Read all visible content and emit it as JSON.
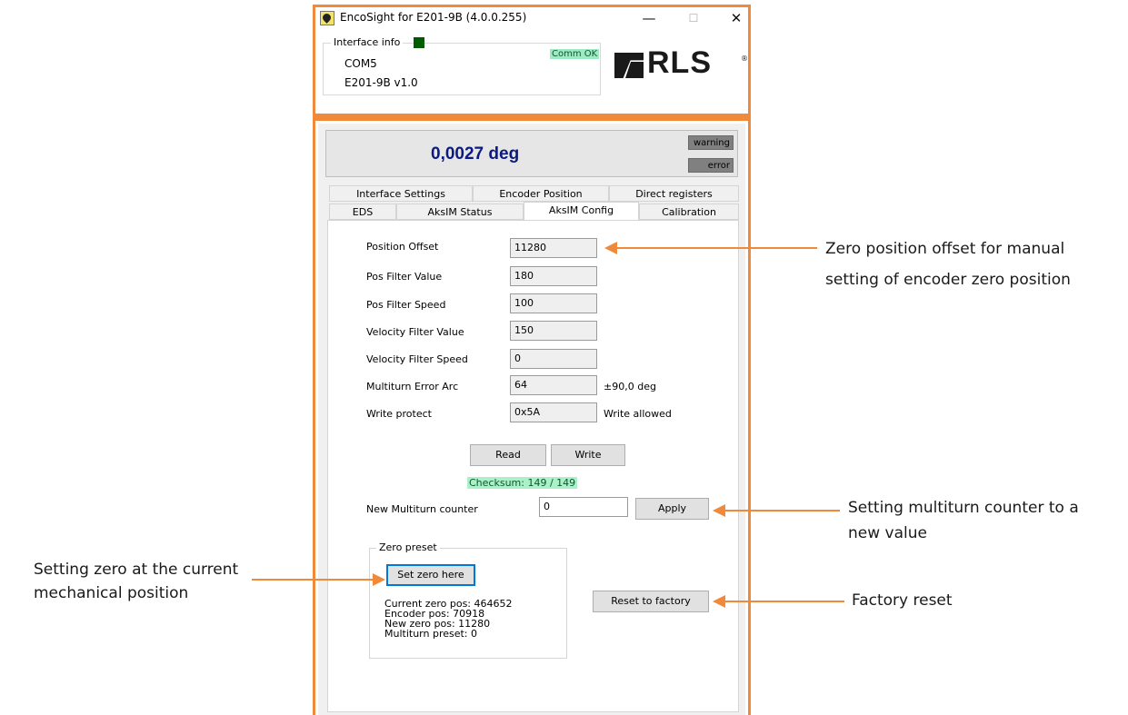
{
  "window": {
    "title": "EncoSight for E201-9B (4.0.0.255)",
    "controls": {
      "minimize": "—",
      "maximize": "☐",
      "close": "✕"
    }
  },
  "interface_info": {
    "legend": "Interface info",
    "status": "Comm OK",
    "port": "COM5",
    "device": "E201-9B v1.0",
    "led_color": "#005a00"
  },
  "logo": {
    "text": "RLS",
    "registered": "®"
  },
  "readout": {
    "value": "0,0027 deg",
    "warning": "warning",
    "error": "error"
  },
  "tabs": {
    "row1": [
      "Interface Settings",
      "Encoder Position",
      "Direct registers"
    ],
    "row2": [
      "EDS",
      "AksIM Status",
      "AksIM Config",
      "Calibration"
    ],
    "active": "AksIM Config"
  },
  "config": {
    "fields": [
      {
        "label": "Position Offset",
        "value": "11280",
        "unit": ""
      },
      {
        "label": "Pos Filter Value",
        "value": "180",
        "unit": ""
      },
      {
        "label": "Pos Filter Speed",
        "value": "100",
        "unit": ""
      },
      {
        "label": "Velocity Filter Value",
        "value": "150",
        "unit": ""
      },
      {
        "label": "Velocity Filter Speed",
        "value": "0",
        "unit": ""
      },
      {
        "label": "Multiturn Error Arc",
        "value": "64",
        "unit": "±90,0 deg"
      },
      {
        "label": "Write protect",
        "value": "0x5A",
        "unit": "Write allowed"
      }
    ],
    "read_label": "Read",
    "write_label": "Write",
    "checksum": "Checksum: 149 / 149",
    "multiturn_label": "New Multiturn counter",
    "multiturn_value": "0",
    "apply_label": "Apply"
  },
  "zero_preset": {
    "legend": "Zero preset",
    "set_zero_label": "Set zero here",
    "current_zero": "Current zero pos: 464652",
    "encoder_pos": "Encoder pos: 70918",
    "new_zero": "New zero pos: 11280",
    "multiturn_preset": "Multiturn preset: 0"
  },
  "factory_reset_label": "Reset to factory",
  "annotations": {
    "offset_line1": "Zero position offset for manual",
    "offset_line2": "setting of encoder zero position",
    "multiturn_line1": "Setting multiturn counter to a",
    "multiturn_line2": "new value",
    "zero_line1": "Setting zero at the current",
    "zero_line2": "mechanical position",
    "factory": "Factory reset",
    "color": "#f08a3a"
  }
}
